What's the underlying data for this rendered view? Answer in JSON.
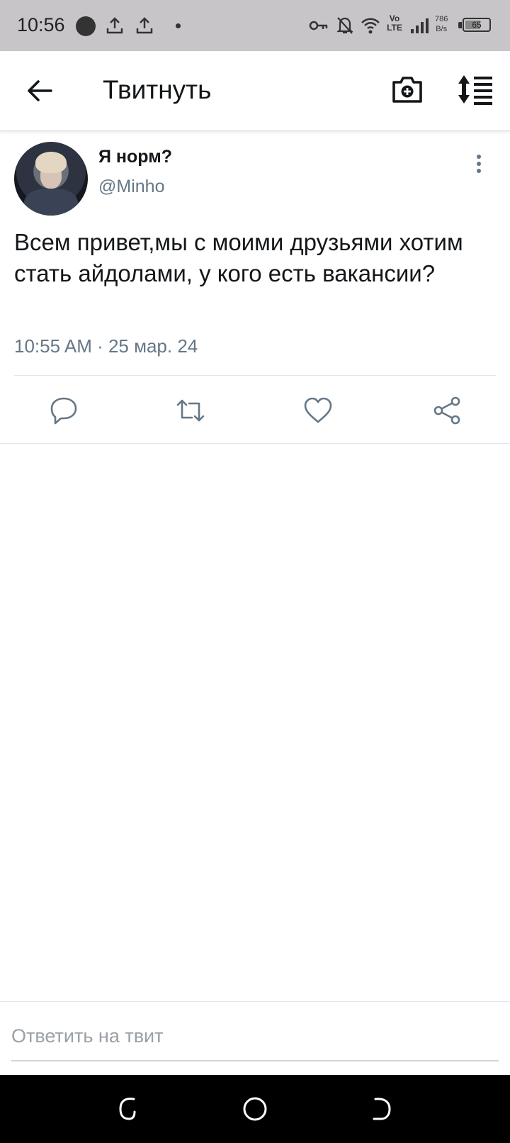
{
  "status_bar": {
    "time": "10:56",
    "network_speed_value": "786",
    "network_speed_unit": "B/s",
    "network_type": "LTE",
    "volte_label": "Vo",
    "battery_level": "65",
    "icons": [
      "record-icon",
      "upload-icon",
      "upload-icon",
      "notification-dot",
      "vpn-key-icon",
      "bell-off-icon",
      "wifi-icon",
      "volte-icon",
      "signal-icon",
      "battery-icon"
    ]
  },
  "app_bar": {
    "title": "Твитнуть",
    "icons": [
      "back-arrow-icon",
      "camera-add-icon",
      "sort-icon"
    ]
  },
  "tweet": {
    "display_name": "Я норм?",
    "handle": "@Minho",
    "text": "Всем привет,мы с моими друзьями хотим стать айдолами, у кого есть вакансии?",
    "timestamp": "10:55 AM · 25 мар. 24",
    "actions": [
      "reply-icon",
      "retweet-icon",
      "like-icon",
      "share-icon"
    ]
  },
  "reply": {
    "placeholder": "Ответить на твит",
    "value": ""
  },
  "colors": {
    "status_bar_bg": "#c7c5c8",
    "text_primary": "#14171a",
    "text_secondary": "#657786",
    "divider": "#e1e8ed",
    "nav_bar_bg": "#000000"
  }
}
